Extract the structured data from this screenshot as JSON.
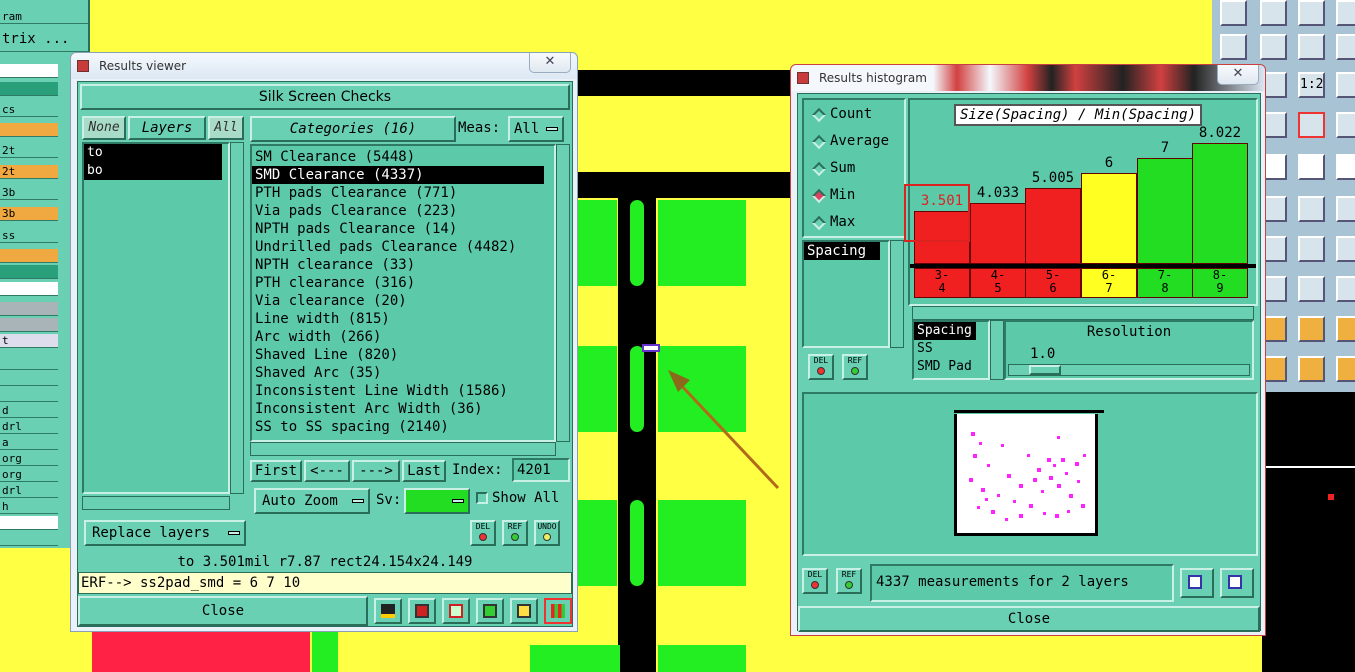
{
  "left_strip": {
    "rows": [
      "",
      "ram",
      "trix ...",
      "",
      "",
      "cs",
      "",
      "2t",
      "2t",
      "3b",
      "3b",
      "ss",
      "",
      "",
      "",
      "",
      "",
      "t",
      "",
      "",
      "",
      "d",
      "drl",
      "a",
      "org",
      "org",
      "drl",
      "h",
      "",
      ""
    ]
  },
  "results_viewer": {
    "title": "Results viewer",
    "header": "Silk Screen Checks",
    "none_label": "None",
    "layers_label": "Layers",
    "all_label": "All",
    "layers": [
      "to",
      "bo"
    ],
    "categories_label": "Categories (16)",
    "meas_label": "Meas:",
    "meas_value": "All",
    "categories": [
      "SM Clearance (5448)",
      "SMD Clearance (4337)",
      "PTH pads Clearance (771)",
      "Via pads Clearance (223)",
      "NPTH pads Clearance (14)",
      "Undrilled pads Clearance (4482)",
      "NPTH clearance (33)",
      "PTH clearance (316)",
      "Via clearance (20)",
      "Line width (815)",
      "Arc width (266)",
      "Shaved Line (820)",
      "Shaved Arc (35)",
      "Inconsistent Line Width (1586)",
      "Inconsistent Arc Width (36)",
      "SS to SS spacing (2140)"
    ],
    "selected_index": 1,
    "first": "First",
    "prev": "<---",
    "next": "--->",
    "last": "Last",
    "index_label": "Index:",
    "index_value": "4201",
    "auto_zoom": "Auto Zoom",
    "sv_label": "Sv:",
    "show_all": "Show All",
    "replace_layers": "Replace layers",
    "del": "DEL",
    "ref": "REF",
    "undo": "UNDO",
    "status": "to 3.501mil  r7.87  rect24.154x24.149",
    "erf": "ERF--> ss2pad_smd = 6 7 10",
    "close": "Close"
  },
  "results_histogram": {
    "title": "Results histogram",
    "modes": [
      "Count",
      "Average",
      "Sum",
      "Min",
      "Max"
    ],
    "selected_mode": "Min",
    "spacing_item": "Spacing",
    "del": "DEL",
    "ref": "REF",
    "chart_title": "Size(Spacing) / Min(Spacing)",
    "measure_list": [
      "Spacing",
      "SS",
      "SMD Pad"
    ],
    "resolution_label": "Resolution",
    "resolution_value": "1.0",
    "summary": "4337 measurements for 2 layers",
    "close": "Close"
  },
  "chart_data": {
    "type": "bar",
    "title": "Size(Spacing) / Min(Spacing)",
    "categories": [
      "3-4",
      "4-5",
      "5-6",
      "6-7",
      "7-8",
      "8-9"
    ],
    "values": [
      3.501,
      4.033,
      5.005,
      6,
      7,
      8.022
    ],
    "value_labels": [
      "3.501",
      "4.033",
      "5.005",
      "6",
      "7",
      "8.022"
    ],
    "colors": [
      "#f02020",
      "#f02020",
      "#f02020",
      "#ffff22",
      "#22dd22",
      "#22dd22"
    ],
    "ylim": [
      0,
      8.6
    ],
    "highlighted_bar": "3-4"
  }
}
